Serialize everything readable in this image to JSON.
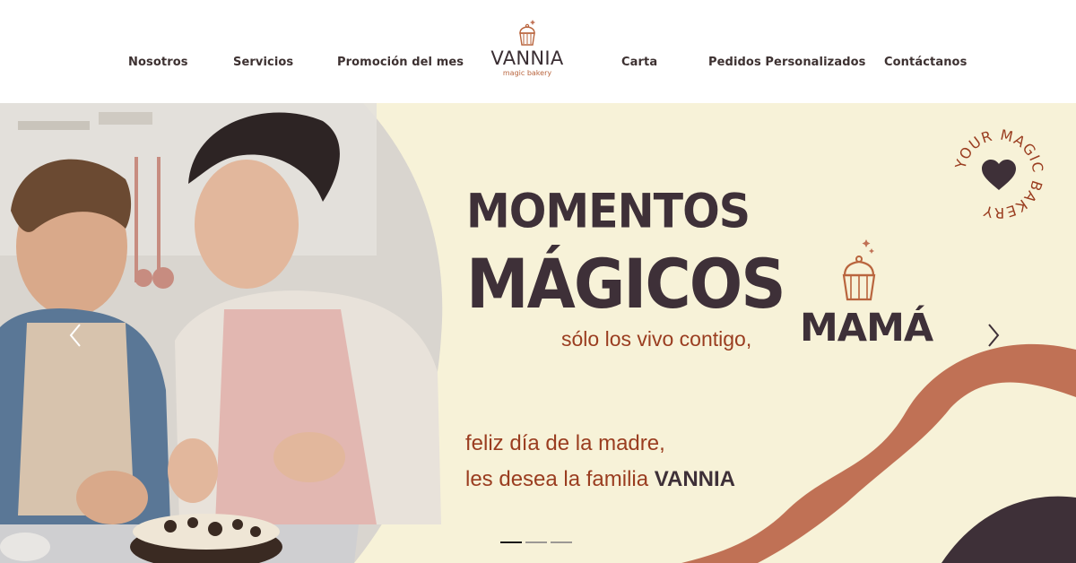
{
  "nav": {
    "items": [
      {
        "label": "Nosotros"
      },
      {
        "label": "Servicios"
      },
      {
        "label": "Promoción del mes"
      },
      {
        "label": "Carta"
      },
      {
        "label": "Pedidos Personalizados"
      },
      {
        "label": "Contáctanos"
      }
    ]
  },
  "logo": {
    "name": "VANNIA",
    "tagline": "magic bakery",
    "icon": "cupcake-icon"
  },
  "hero": {
    "title_line1": "MOMENTOS",
    "title_line2": "MÁGICOS",
    "subtitle": "sólo los vivo contigo,",
    "emphasis": "MAMÁ",
    "greeting_line1": "feliz día de la madre,",
    "greeting_line2_prefix": "les desea la familia",
    "greeting_line2_brand": "VANNIA",
    "badge_text": "YOUR MAGIC BAKERY",
    "badge_icon": "heart-icon",
    "prev_icon": "chevron-left-icon",
    "next_icon": "chevron-right-icon",
    "slides_total": 3,
    "active_slide": 1
  },
  "colors": {
    "cream": "#f7f2d8",
    "dark": "#3e3038",
    "rust": "#9a3d20",
    "terracotta": "#c07155",
    "plum": "#3e3038"
  }
}
